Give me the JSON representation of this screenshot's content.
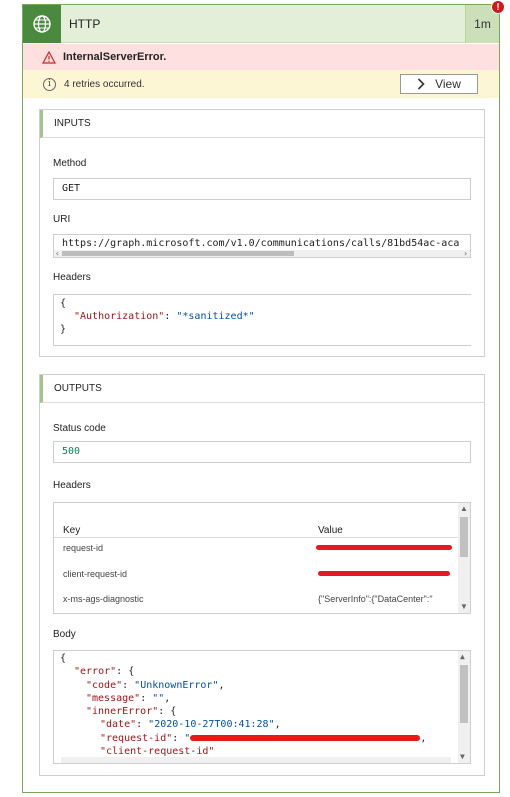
{
  "action": {
    "title": "HTTP",
    "duration": "1m",
    "error_badge": "!"
  },
  "error": {
    "message": "InternalServerError."
  },
  "info": {
    "message": "4 retries occurred.",
    "view_label": "View"
  },
  "inputs": {
    "title": "INPUTS",
    "method_label": "Method",
    "method_value": "GET",
    "uri_label": "URI",
    "uri_value": "https://graph.microsoft.com/v1.0/communications/calls/81bd54ac-aca",
    "headers_label": "Headers",
    "headers_lines": [
      "{",
      "\"Authorization\"",
      ":",
      "\"*sanitized*\"",
      "}"
    ]
  },
  "outputs": {
    "title": "OUTPUTS",
    "status_label": "Status code",
    "status_value": "500",
    "headers_label": "Headers",
    "col_key": "Key",
    "col_value": "Value",
    "rows": [
      {
        "key": "request-id",
        "value": ""
      },
      {
        "key": "client-request-id",
        "value": ""
      },
      {
        "key": "x-ms-ags-diagnostic",
        "value": "{\"ServerInfo\":{\"DataCenter\":\""
      }
    ],
    "body_label": "Body",
    "body": {
      "open": "{",
      "error_key": "\"error\"",
      "code_key": "\"code\"",
      "code_val": "\"UnknownError\"",
      "message_key": "\"message\"",
      "message_val": "\"\"",
      "inner_key": "\"innerError\"",
      "date_key": "\"date\"",
      "date_val": "\"2020-10-27T00:41:28\"",
      "reqid_key": "\"request-id\"",
      "reqid_val": "\"",
      "clientreq_key": "\"client-request-id\""
    }
  },
  "colors": {
    "header_bg": "#e3efd8",
    "accent": "#4a8a3f",
    "error_bg": "#fde0df",
    "info_bg": "#fdf6d5",
    "redaction": "#e8191c"
  }
}
